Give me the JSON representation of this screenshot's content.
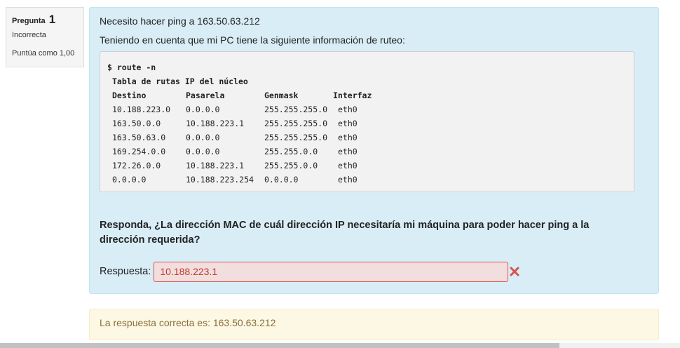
{
  "question_info": {
    "label": "Pregunta",
    "number": "1",
    "state": "Incorrecta",
    "grade": "Puntúa como 1,00"
  },
  "question": {
    "line1": "Necesito hacer ping a 163.50.63.212",
    "line2": "Teniendo en cuenta que mi PC tiene la siguiente información de ruteo:",
    "code": {
      "command": "$ route -n",
      "title": "Tabla de rutas IP del núcleo",
      "headers": [
        "Destino",
        "Pasarela",
        "Genmask",
        "Interfaz"
      ],
      "rows": [
        [
          "10.188.223.0",
          "0.0.0.0",
          "255.255.255.0",
          "eth0"
        ],
        [
          "163.50.0.0",
          "10.188.223.1",
          "255.255.255.0",
          "eth0"
        ],
        [
          "163.50.63.0",
          "0.0.0.0",
          "255.255.255.0",
          "eth0"
        ],
        [
          "169.254.0.0",
          "0.0.0.0",
          "255.255.0.0",
          "eth0"
        ],
        [
          "172.26.0.0",
          "10.188.223.1",
          "255.255.0.0",
          "eth0"
        ],
        [
          "0.0.0.0",
          "10.188.223.254",
          "0.0.0.0",
          "eth0"
        ]
      ]
    },
    "prompt": "Responda, ¿La dirección MAC de cuál dirección IP necesitaría mi máquina para poder hacer ping a la dirección requerida?",
    "answer_label": "Respuesta:",
    "answer_value": "10.188.223.1"
  },
  "feedback": {
    "text": "La respuesta correcta es: 163.50.63.212"
  },
  "icons": {
    "incorrect": "close-icon"
  },
  "colors": {
    "question_bg": "#d9edf7",
    "feedback_bg": "#fcf8e3",
    "incorrect_red": "#d9534f"
  }
}
